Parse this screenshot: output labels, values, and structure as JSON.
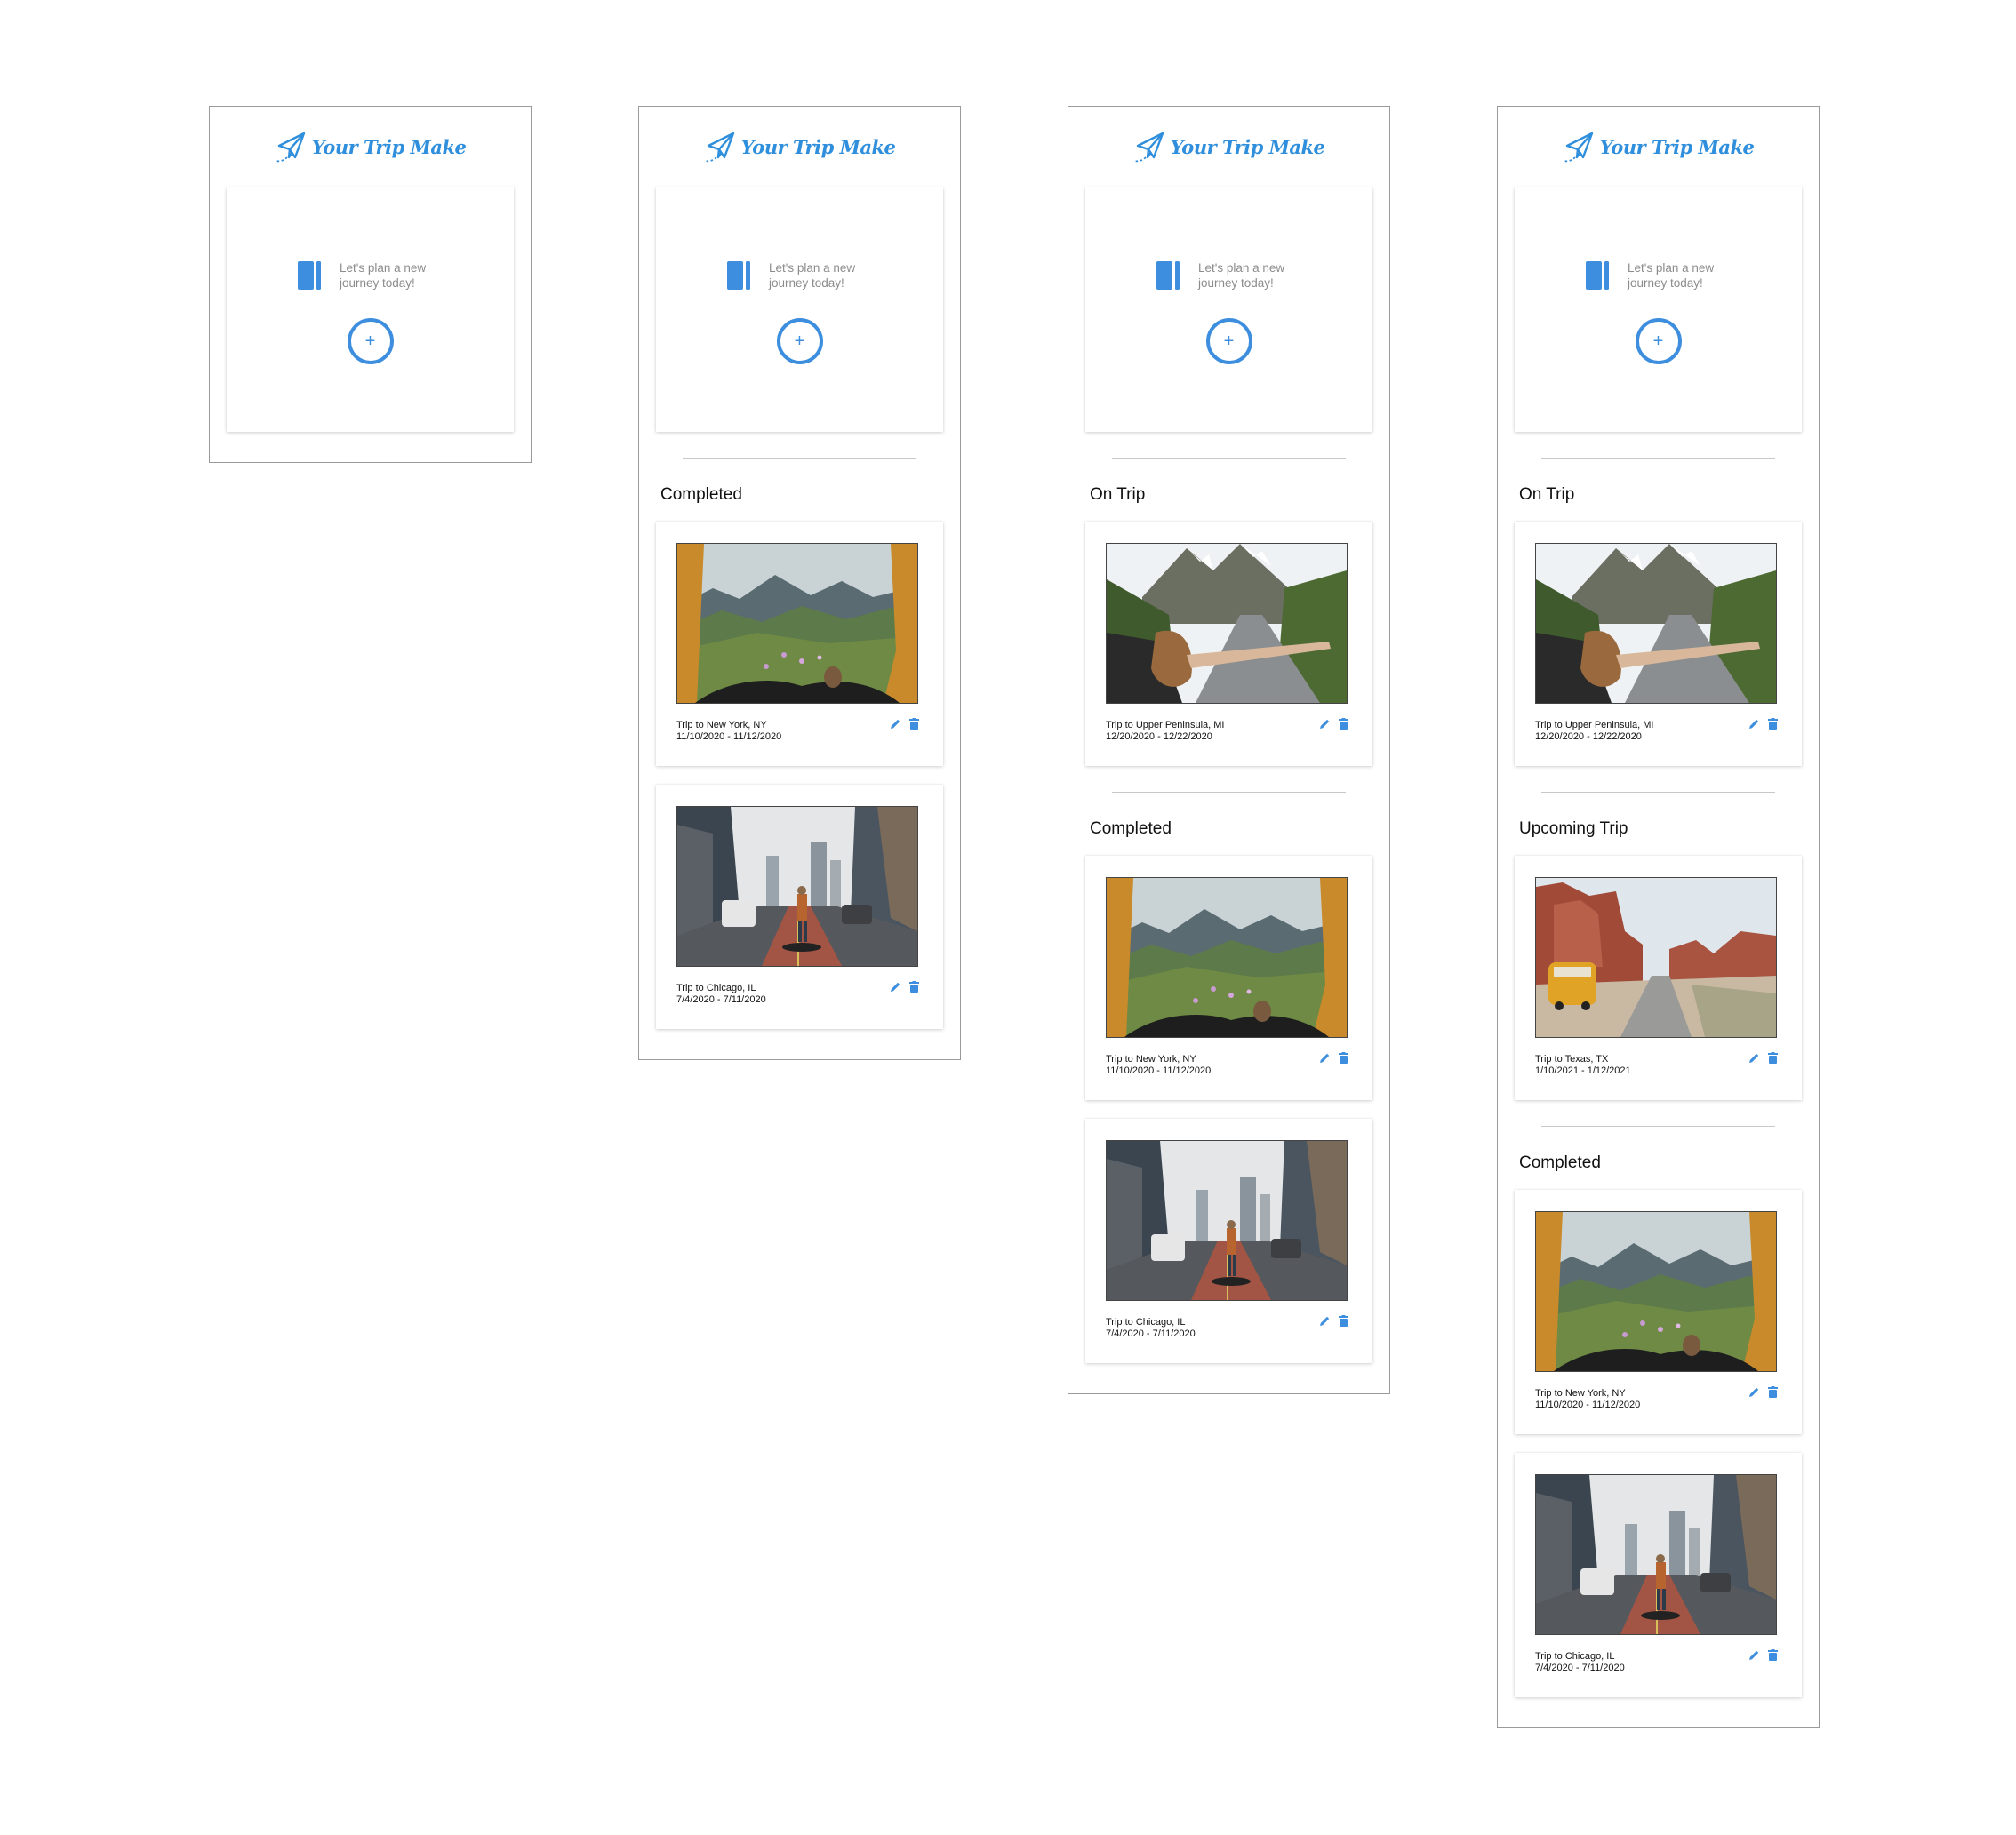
{
  "app": {
    "brand": "Your Trip Make",
    "plan_prompt": "Let's plan a new journey today!",
    "add_label": "+"
  },
  "colors": {
    "accent": "#3d8ede",
    "brand": "#2f8fdc",
    "text": "#111111",
    "muted": "#8c8c8c"
  },
  "icons": {
    "brand": "paper-plane-icon",
    "plan": "notebook-icon",
    "add": "plus-circle-icon",
    "edit": "pencil-icon",
    "delete": "trash-icon"
  },
  "screens": [
    {
      "sections": []
    },
    {
      "sections": [
        {
          "title": "Completed",
          "trips": [
            {
              "name": "Trip to New York, NY",
              "dates": "11/10/2020 - 11/12/2020",
              "photo": "mountain-tent"
            },
            {
              "name": "Trip to Chicago, IL",
              "dates": "7/4/2020 - 7/11/2020",
              "photo": "city-street"
            }
          ]
        }
      ]
    },
    {
      "sections": [
        {
          "title": "On Trip",
          "trips": [
            {
              "name": "Trip to Upper Peninsula, MI",
              "dates": "12/20/2020 - 12/22/2020",
              "photo": "road-car-window"
            }
          ]
        },
        {
          "title": "Completed",
          "trips": [
            {
              "name": "Trip to New York, NY",
              "dates": "11/10/2020 - 11/12/2020",
              "photo": "mountain-tent"
            },
            {
              "name": "Trip to Chicago, IL",
              "dates": "7/4/2020 - 7/11/2020",
              "photo": "city-street"
            }
          ]
        }
      ]
    },
    {
      "sections": [
        {
          "title": "On Trip",
          "trips": [
            {
              "name": "Trip to Upper Peninsula, MI",
              "dates": "12/20/2020 - 12/22/2020",
              "photo": "road-car-window"
            }
          ]
        },
        {
          "title": "Upcoming Trip",
          "trips": [
            {
              "name": "Trip to Texas, TX",
              "dates": "1/10/2021 - 1/12/2021",
              "photo": "desert-van"
            }
          ]
        },
        {
          "title": "Completed",
          "trips": [
            {
              "name": "Trip to New York, NY",
              "dates": "11/10/2020 - 11/12/2020",
              "photo": "mountain-tent"
            },
            {
              "name": "Trip to Chicago, IL",
              "dates": "7/4/2020 - 7/11/2020",
              "photo": "city-street"
            }
          ]
        }
      ]
    }
  ]
}
